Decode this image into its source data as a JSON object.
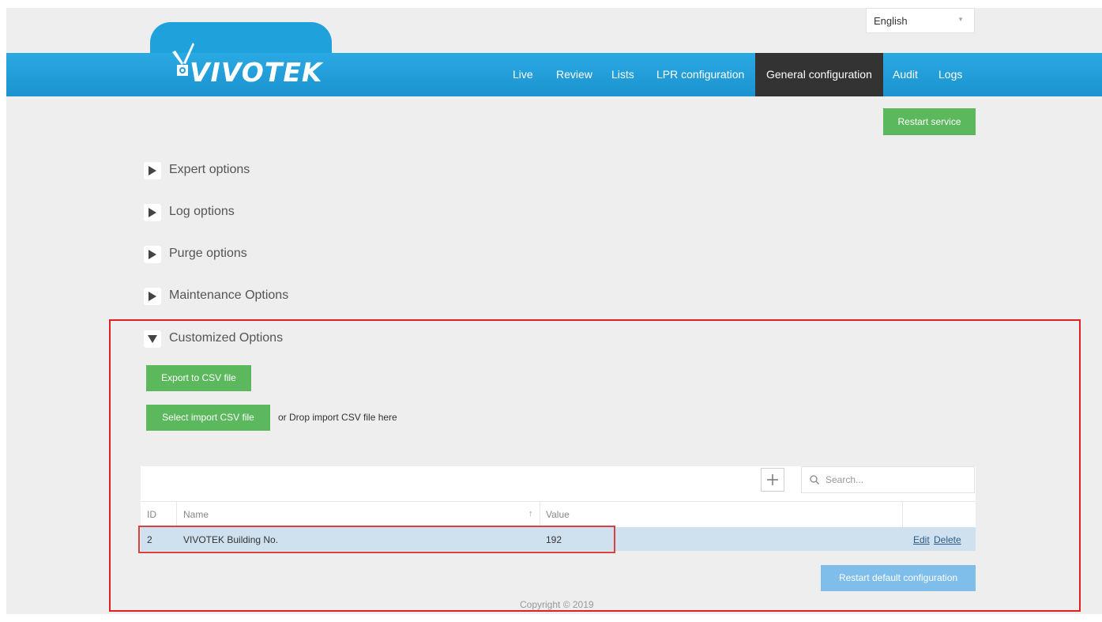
{
  "language": {
    "selected": "English"
  },
  "brand": {
    "logo_text": "VIVOTEK"
  },
  "nav": [
    {
      "label": "Live",
      "active": false
    },
    {
      "label": "Review",
      "active": false
    },
    {
      "label": "Lists",
      "active": false
    },
    {
      "label": "LPR configuration",
      "active": false
    },
    {
      "label": "General configuration",
      "active": true
    },
    {
      "label": "Audit",
      "active": false
    },
    {
      "label": "Logs",
      "active": false
    }
  ],
  "restart_service_label": "Restart service",
  "sections": [
    {
      "label": "Expert options",
      "expanded": false
    },
    {
      "label": "Log options",
      "expanded": false
    },
    {
      "label": "Purge options",
      "expanded": false
    },
    {
      "label": "Maintenance Options",
      "expanded": false
    },
    {
      "label": "Customized Options",
      "expanded": true
    }
  ],
  "customized": {
    "export_label": "Export to CSV file",
    "import_label": "Select import CSV file",
    "drop_text": "or Drop import CSV file here",
    "search_placeholder": "Search...",
    "add_icon": "plus-icon",
    "columns": {
      "id": "ID",
      "name": "Name",
      "value": "Value"
    },
    "sort_indicator": "↑",
    "rows": [
      {
        "id": "2",
        "name": "VIVOTEK Building No.",
        "value": "192",
        "edit": "Edit",
        "delete": "Delete"
      }
    ],
    "restart_default_label": "Restart default configuration"
  },
  "copyright": "Copyright © 2019",
  "colors": {
    "header_blue": "#1fa1dc",
    "active_nav": "#333333",
    "green_button": "#5cb85c",
    "light_blue_button": "#7fbdea",
    "selected_row": "#cfe0ee",
    "annotation_red": "#e02020"
  }
}
